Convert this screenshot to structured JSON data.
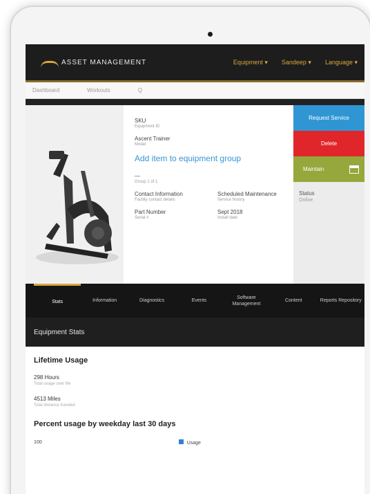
{
  "header": {
    "logo_text": "ASSET MANAGEMENT",
    "nav": [
      "Equipment ▾",
      "Sandeep ▾",
      "Language ▾"
    ]
  },
  "breadcrumb": [
    "Dashboard",
    "Workouts",
    "Q"
  ],
  "equipment": {
    "id_label": "SKU",
    "id_sub": "Equipment ID",
    "model_label": "Ascent Trainer",
    "model_sub": "Model",
    "link_text": "Add item to equipment group",
    "group_label": "—",
    "group_sub": "Group 1 of 1",
    "contact_label": "Contact Information",
    "contact_sub": "Facility contact details",
    "sched_label": "Scheduled Maintenance",
    "sched_sub": "Service history",
    "serial_label": "Part Number",
    "serial_sub": "Serial #",
    "date_label": "Sept 2018",
    "date_sub": "Install date"
  },
  "actions": {
    "request_service": "Request Service",
    "delete": "Delete",
    "schedule": "Maintain"
  },
  "status": {
    "label": "Status",
    "value": "Online"
  },
  "tabs": [
    "Stats",
    "Information",
    "Diagnostics",
    "Events",
    "Software Management",
    "Content",
    "Reports Repository"
  ],
  "section_title": "Equipment Stats",
  "lifetime": {
    "heading": "Lifetime Usage",
    "metrics": [
      {
        "label": "298 Hours",
        "sub": "Total usage over life"
      },
      {
        "label": "4513 Miles",
        "sub": "Total distance traveled"
      }
    ]
  },
  "usage_heading": "Percent usage by weekday last 30 days",
  "chart": {
    "legend": "Usage",
    "tick": "100"
  }
}
